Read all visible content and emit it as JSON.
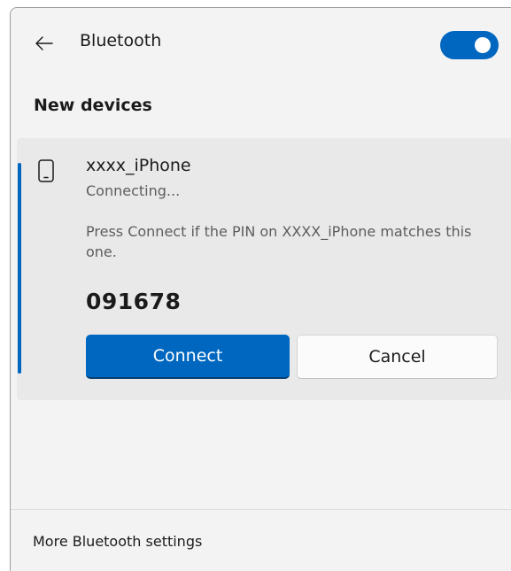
{
  "header": {
    "back_icon": "back-arrow-icon",
    "title": "Bluetooth",
    "toggle_state": "on"
  },
  "section": {
    "title": "New devices"
  },
  "device": {
    "icon": "phone-icon",
    "name": "xxxx_iPhone",
    "status": "Connecting...",
    "message": "Press Connect if the PIN on XXXX_iPhone matches this one.",
    "pin": "091678"
  },
  "actions": {
    "connect_label": "Connect",
    "cancel_label": "Cancel"
  },
  "footer": {
    "link_label": "More Bluetooth settings"
  },
  "colors": {
    "accent": "#0067c0",
    "panel_bg": "#f3f3f3",
    "card_bg": "#e9e9e9"
  }
}
